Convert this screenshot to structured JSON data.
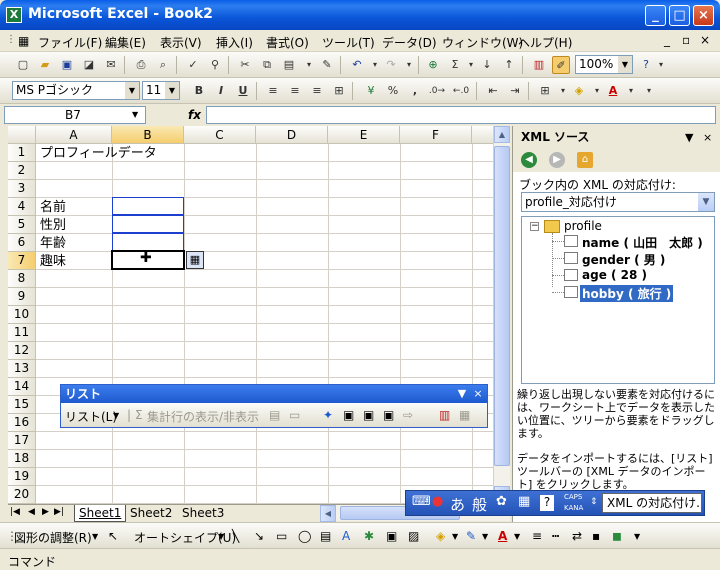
{
  "window": {
    "title": "Microsoft Excel - Book2",
    "app_icon": "X"
  },
  "menu": {
    "items": [
      "ファイル(F)",
      "編集(E)",
      "表示(V)",
      "挿入(I)",
      "書式(O)",
      "ツール(T)",
      "データ(D)",
      "ウィンドウ(W)",
      "ヘルプ(H)"
    ],
    "doc_controls": [
      "_",
      "×"
    ]
  },
  "toolbar": {
    "zoom": "100%"
  },
  "format": {
    "font_name": "MS Pゴシック",
    "font_size": "11",
    "bold": "B",
    "italic": "I",
    "underline": "U",
    "percent": "%",
    "comma": ","
  },
  "formula": {
    "name_box": "B7",
    "fx": "fx",
    "content": ""
  },
  "sheet": {
    "columns": [
      "A",
      "B",
      "C",
      "D",
      "E",
      "F"
    ],
    "rows": [
      "1",
      "2",
      "3",
      "4",
      "5",
      "6",
      "7",
      "8",
      "9",
      "10",
      "11",
      "12",
      "13",
      "14",
      "15",
      "16",
      "17",
      "18",
      "19",
      "20"
    ],
    "cells": {
      "A1": "プロフィールデータ",
      "A4": "名前",
      "A5": "性別",
      "A6": "年齢",
      "A7": "趣味"
    },
    "tabs": [
      "Sheet1",
      "Sheet2",
      "Sheet3"
    ]
  },
  "list_toolbar": {
    "title": "リスト",
    "list_menu": "リスト(L)",
    "sum_toggle": "集計行の表示/非表示"
  },
  "xml_pane": {
    "title": "XML ソース",
    "map_label": "ブック内の XML の対応付け:",
    "map_selected": "profile_対応付け",
    "tree": {
      "root": "profile",
      "children": [
        "name ( 山田　太郎 )",
        "gender ( 男 )",
        "age ( 28 )",
        "hobby ( 旅行 )"
      ]
    },
    "help1": "繰り返し出現しない要素を対応付けるには、ワークシート上でデータを表示したい位置に、ツリーから要素をドラッグします。",
    "help2": "データをインポートするには、[リスト] ツールバーの [XML データのインポート] をクリックします。"
  },
  "drawing": {
    "adjust": "図形の調整(R)",
    "autoshape": "オートシェイプ(U)"
  },
  "language_bar": {
    "ime": "あ",
    "mode": "般",
    "caps": "CAPS",
    "kana": "KANA",
    "map_button": "XML の対応付け..."
  },
  "status": {
    "text": "コマンド"
  }
}
